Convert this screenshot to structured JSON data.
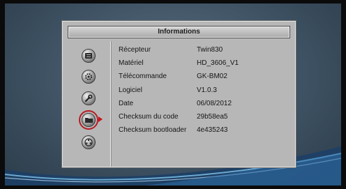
{
  "dialog": {
    "title": "Informations"
  },
  "sidebar": {
    "items": [
      {
        "icon": "disc-icon",
        "selected": false
      },
      {
        "icon": "gear-icon",
        "selected": false
      },
      {
        "icon": "wrench-icon",
        "selected": false
      },
      {
        "icon": "folder-icon",
        "selected": true
      },
      {
        "icon": "film-reel-icon",
        "selected": false
      }
    ]
  },
  "info": {
    "rows": [
      {
        "label": "Récepteur",
        "value": "Twin830"
      },
      {
        "label": "Matériel",
        "value": "HD_3606_V1"
      },
      {
        "label": "Télécommande",
        "value": "GK-BM02"
      },
      {
        "label": "Logiciel",
        "value": "V1.0.3"
      },
      {
        "label": "Date",
        "value": "06/08/2012"
      },
      {
        "label": "Checksum du code",
        "value": "29b58ea5"
      },
      {
        "label": "Checksum bootloader",
        "value": "4e435243"
      }
    ]
  },
  "colors": {
    "background": "#4a5e70",
    "panel": "#b7b7b7",
    "accent": "#b51d24"
  }
}
